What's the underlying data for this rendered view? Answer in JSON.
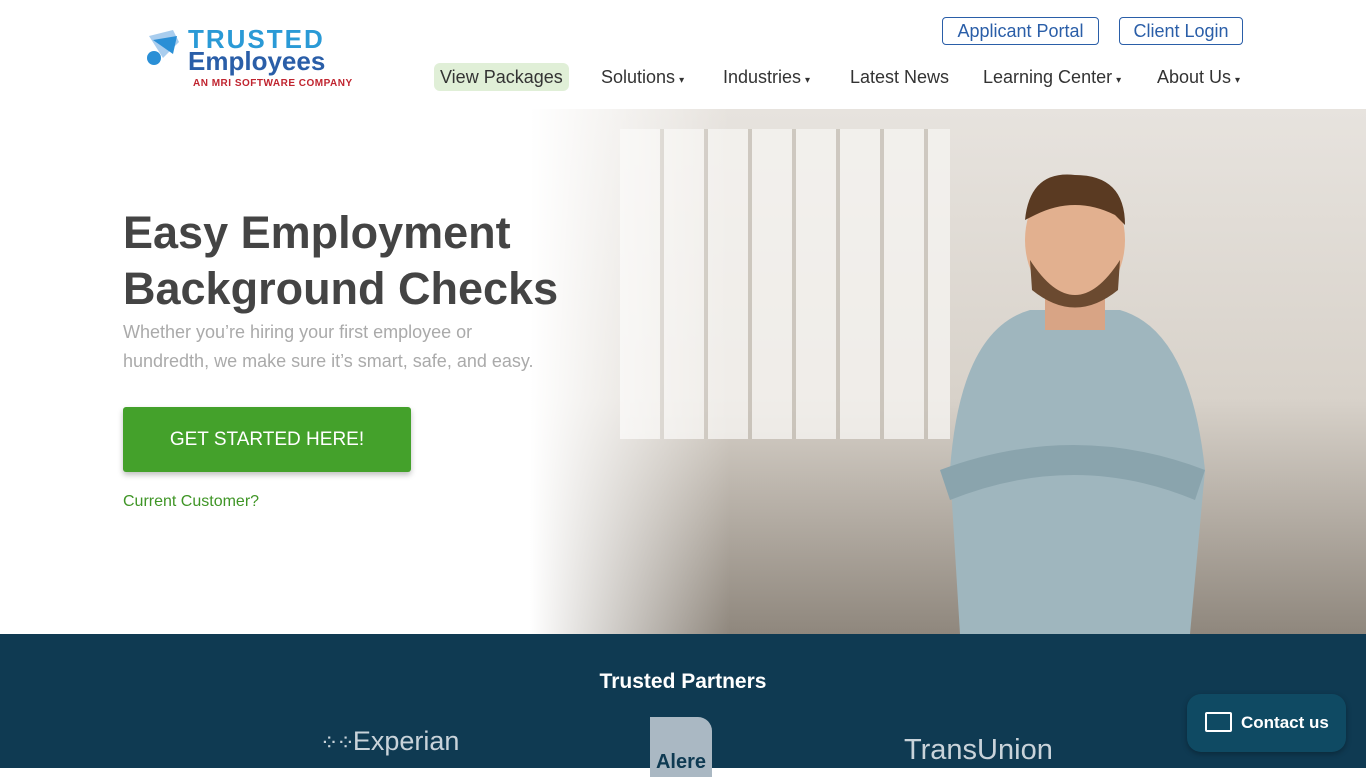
{
  "header": {
    "logo": {
      "line1": "TRUSTED",
      "line2": "Employees",
      "tagline": "AN MRI SOFTWARE COMPANY"
    },
    "applicant_portal": "Applicant Portal",
    "client_login": "Client Login",
    "nav": [
      {
        "label": "View Packages",
        "active": true
      },
      {
        "label": "Solutions",
        "dropdown": true
      },
      {
        "label": "Industries",
        "dropdown": true
      },
      {
        "label": "Latest News"
      },
      {
        "label": "Learning Center",
        "dropdown": true
      },
      {
        "label": "About Us",
        "dropdown": true
      }
    ]
  },
  "hero": {
    "title_line1": "Easy Employment",
    "title_line2": "Background Checks",
    "subtitle": "Whether you’re hiring your first employee or hundredth, we make sure it’s smart, safe, and easy.",
    "cta": "GET STARTED HERE!",
    "current_customer": "Current Customer?"
  },
  "partners": {
    "title": "Trusted Partners",
    "logos": [
      "Experian",
      "Alere",
      "TransUnion"
    ]
  },
  "contact": {
    "label": "Contact us"
  },
  "colors": {
    "brand_blue": "#2a5ea8",
    "cta_green": "#44a12b",
    "partners_bg": "#0f3a52"
  }
}
